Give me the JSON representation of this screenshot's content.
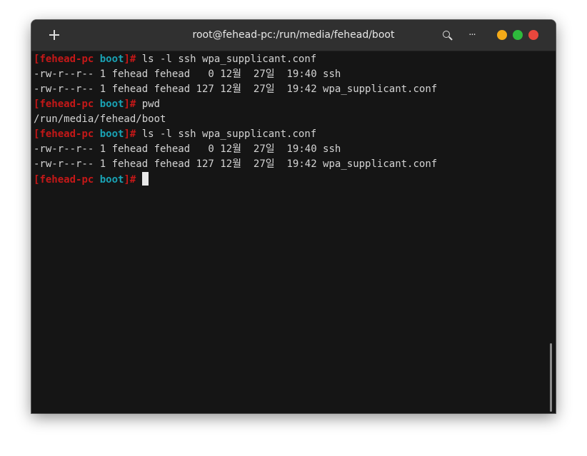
{
  "window": {
    "title": "root@fehead-pc:/run/media/fehead/boot",
    "new_tab_icon": "plus-icon",
    "search_icon": "search-icon",
    "menu_icon": "more-horizontal-icon",
    "menu_glyph": "···",
    "controls": {
      "minimize_color": "#f4aa18",
      "maximize_color": "#2ebb3c",
      "close_color": "#e9473d"
    }
  },
  "terminal": {
    "prompt": {
      "open": "[",
      "host": "fehead-pc",
      "dir": "boot",
      "close": "]#"
    },
    "lines": [
      {
        "type": "prompt",
        "command": "ls -l ssh wpa_supplicant.conf"
      },
      {
        "type": "output",
        "text": "-rw-r--r-- 1 fehead fehead   0 12월  27일  19:40 ssh"
      },
      {
        "type": "output",
        "text": "-rw-r--r-- 1 fehead fehead 127 12월  27일  19:42 wpa_supplicant.conf"
      },
      {
        "type": "prompt",
        "command": "pwd"
      },
      {
        "type": "output",
        "text": "/run/media/fehead/boot"
      },
      {
        "type": "prompt",
        "command": "ls -l ssh wpa_supplicant.conf"
      },
      {
        "type": "output",
        "text": "-rw-r--r-- 1 fehead fehead   0 12월  27일  19:40 ssh"
      },
      {
        "type": "output",
        "text": "-rw-r--r-- 1 fehead fehead 127 12월  27일  19:42 wpa_supplicant.conf"
      },
      {
        "type": "prompt",
        "command": ""
      }
    ],
    "colors": {
      "prompt_host": "#c51818",
      "prompt_dir": "#19a2b4",
      "text": "#d4d4d4",
      "background": "#151515"
    }
  }
}
